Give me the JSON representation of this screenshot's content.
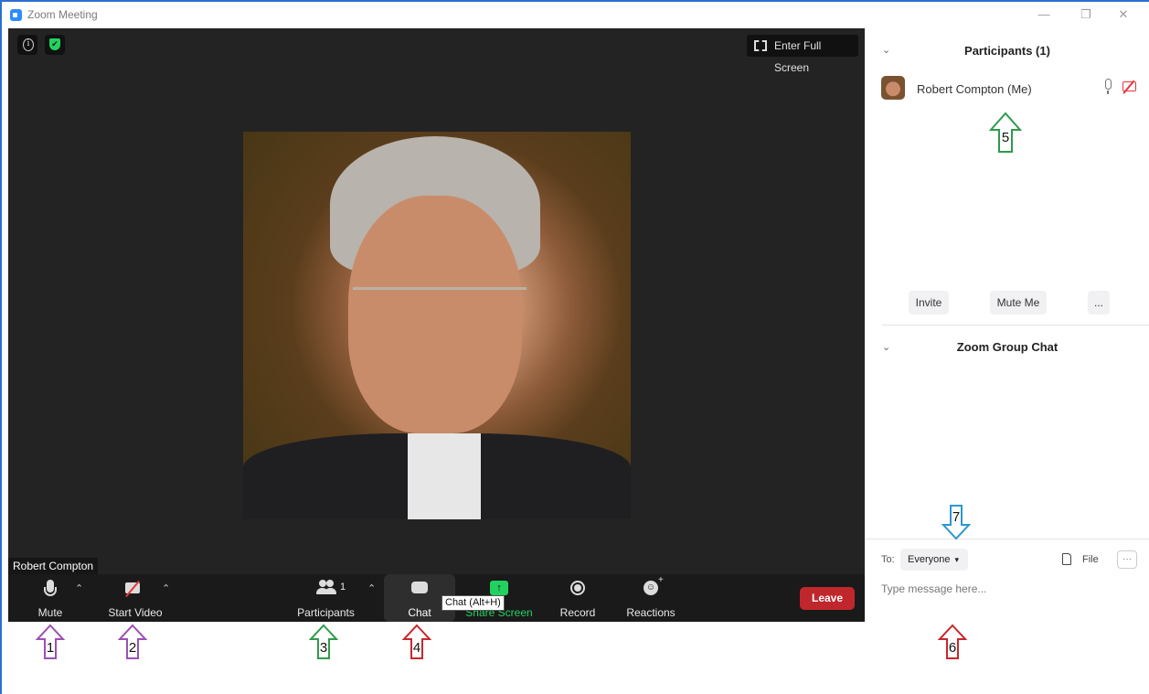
{
  "window": {
    "title": "Zoom Meeting",
    "controls": [
      "minimize-icon",
      "restore-icon",
      "close-icon"
    ]
  },
  "video": {
    "full_screen_label": "Enter Full Screen",
    "participant_name_tag": "Robert Compton"
  },
  "toolbar": {
    "mute_label": "Mute",
    "start_video_label": "Start Video",
    "participants_label": "Participants",
    "participants_count": "1",
    "chat_label": "Chat",
    "share_screen_label": "Share Screen",
    "record_label": "Record",
    "reactions_label": "Reactions",
    "leave_label": "Leave",
    "chat_tooltip": "Chat (Alt+H)"
  },
  "participants_panel": {
    "title": "Participants (1)",
    "participants": [
      {
        "name": "Robert Compton (Me)"
      }
    ],
    "buttons": {
      "invite": "Invite",
      "mute_me": "Mute Me",
      "more": "..."
    }
  },
  "chat_panel": {
    "title": "Zoom Group Chat",
    "to_label": "To:",
    "recipient": "Everyone",
    "file_label": "File",
    "more_label": "···",
    "message_placeholder": "Type message here..."
  },
  "annotations": [
    {
      "number": "1",
      "color": "#9b4fb3",
      "direction": "up"
    },
    {
      "number": "2",
      "color": "#9b4fb3",
      "direction": "up"
    },
    {
      "number": "3",
      "color": "#2e9b4a",
      "direction": "up"
    },
    {
      "number": "4",
      "color": "#c6282e",
      "direction": "up"
    },
    {
      "number": "5",
      "color": "#2e9b4a",
      "direction": "up"
    },
    {
      "number": "6",
      "color": "#c6282e",
      "direction": "up"
    },
    {
      "number": "7",
      "color": "#2a98cf",
      "direction": "down"
    }
  ],
  "colors": {
    "accent": "#2d8cff",
    "leave": "#c0272d",
    "share": "#23d160",
    "video_bg": "#232323",
    "toolbar_bg": "#1a1a1a"
  }
}
